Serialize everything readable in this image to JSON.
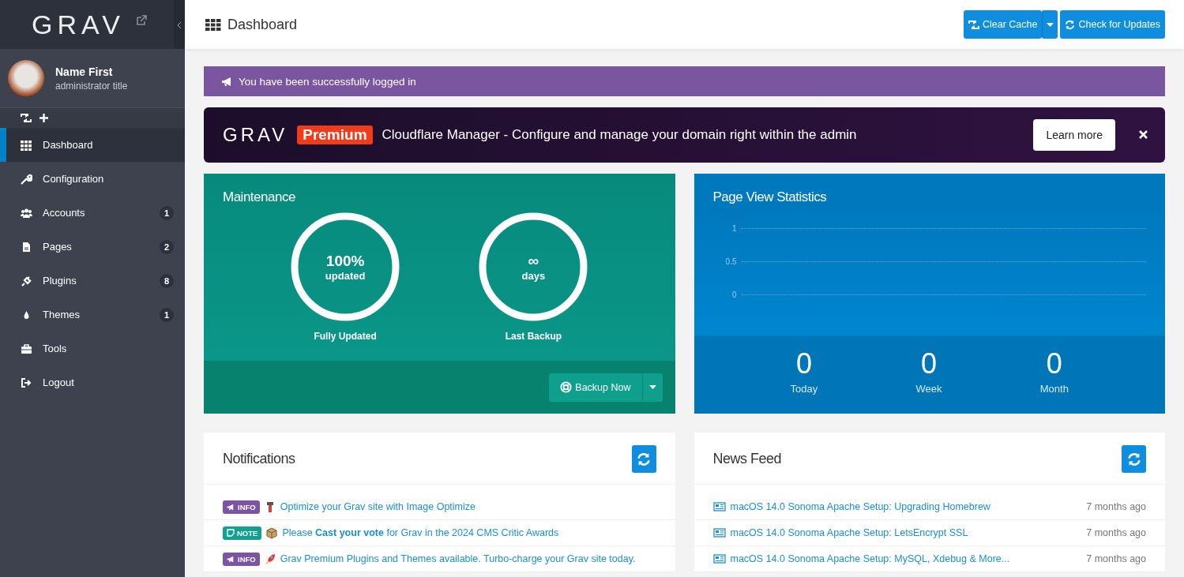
{
  "sidebar": {
    "logo": "GRAV",
    "user": {
      "name": "Name First",
      "title": "administrator title"
    },
    "items": [
      {
        "label": "Dashboard",
        "selected": true
      },
      {
        "label": "Configuration",
        "selected": false
      },
      {
        "label": "Accounts",
        "badge": "1",
        "selected": false
      },
      {
        "label": "Pages",
        "badge": "2",
        "selected": false
      },
      {
        "label": "Plugins",
        "badge": "8",
        "selected": false
      },
      {
        "label": "Themes",
        "badge": "1",
        "selected": false
      },
      {
        "label": "Tools",
        "selected": false
      },
      {
        "label": "Logout",
        "selected": false
      }
    ]
  },
  "header": {
    "title": "Dashboard",
    "buttons": [
      "Clear Cache",
      "Check for Updates"
    ]
  },
  "alert": "You have been successfully logged in",
  "promo": {
    "logo": "GRAV",
    "badge": "Premium",
    "text": "Cloudflare Manager - Configure and manage your domain right within the admin",
    "button": "Learn more"
  },
  "maintenance": {
    "title": "Maintenance",
    "rings": [
      {
        "value": "100%",
        "unit": "updated",
        "caption": "Fully Updated"
      },
      {
        "value": "∞",
        "unit": "days",
        "caption": "Last Backup"
      }
    ],
    "button": "Backup Now"
  },
  "stats": {
    "title": "Page View Statistics",
    "y_labels": [
      "1",
      "0.5",
      "0"
    ],
    "counters": [
      {
        "value": "0",
        "label": "Today"
      },
      {
        "value": "0",
        "label": "Week"
      },
      {
        "value": "0",
        "label": "Month"
      }
    ]
  },
  "notifications": {
    "title": "Notifications",
    "items": [
      {
        "kind": "info",
        "tag": "INFO",
        "text": "Optimize your Grav site with Image Optimize"
      },
      {
        "kind": "note",
        "tag": "NOTE",
        "text": "Please **Cast your vote** for Grav in the 2024 CMS Critic Awards"
      },
      {
        "kind": "info",
        "tag": "INFO",
        "text": "Grav Premium Plugins and Themes available. Turbo-charge your Grav site today."
      }
    ]
  },
  "news": {
    "title": "News Feed",
    "items": [
      {
        "title": "macOS 14.0 Sonoma Apache Setup: Upgrading Homebrew",
        "time": "7 months ago"
      },
      {
        "title": "macOS 14.0 Sonoma Apache Setup: LetsEncrypt SSL",
        "time": "7 months ago"
      },
      {
        "title": "macOS 14.0 Sonoma Apache Setup: MySQL, Xdebug & More...",
        "time": "7 months ago"
      }
    ]
  }
}
